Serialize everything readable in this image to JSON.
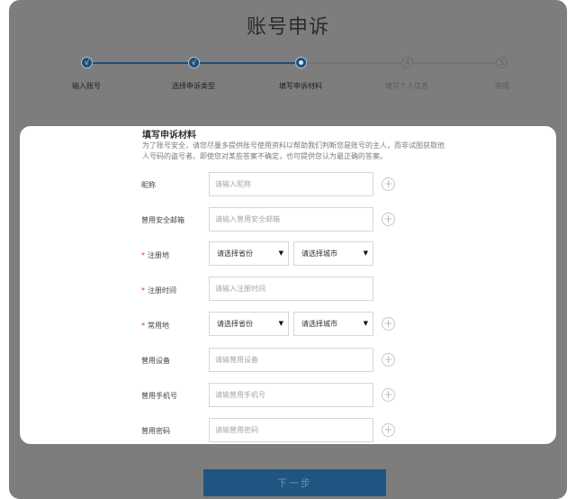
{
  "title": "账号申诉",
  "steps": [
    {
      "label": "输入账号",
      "status": "done",
      "mark": "√"
    },
    {
      "label": "选择申诉类型",
      "status": "done",
      "mark": "√"
    },
    {
      "label": "填写申诉材料",
      "status": "current",
      "mark": ""
    },
    {
      "label": "填写个人信息",
      "status": "todo",
      "mark": "4"
    },
    {
      "label": "完成",
      "status": "todo",
      "mark": "5"
    }
  ],
  "form": {
    "heading": "填写申诉材料",
    "description": "为了账号安全，请您尽量多提供账号使用资料以帮助我们判断您是账号的主人，而非试图获取他人号码的盗号者。即使您对某些答案不确定，也可提供您认为最正确的答案。",
    "fields": {
      "nickname": {
        "label": "昵称",
        "placeholder": "请输入昵称"
      },
      "email": {
        "label": "曾用安全邮箱",
        "placeholder": "请输入曾用安全邮箱"
      },
      "reg_place": {
        "label": "注册地",
        "province": "请选择省份",
        "city": "请选择城市"
      },
      "reg_time": {
        "label": "注册时间",
        "placeholder": "请输入注册时间"
      },
      "usual_place": {
        "label": "常用地",
        "province": "请选择省份",
        "city": "请选择城市"
      },
      "device": {
        "label": "曾用设备",
        "placeholder": "请输曾用设备"
      },
      "phone": {
        "label": "曾用手机号",
        "placeholder": "请输曾用手机号"
      },
      "password": {
        "label": "曾用密码",
        "placeholder": "请输曾用密码"
      }
    },
    "required_mark": "*",
    "plus_glyph": "+",
    "caret_glyph": "▼"
  },
  "next_button": "下一步",
  "colors": {
    "accent": "#1f5580",
    "overlay": "#7d7d7d",
    "required": "#dd3333"
  }
}
